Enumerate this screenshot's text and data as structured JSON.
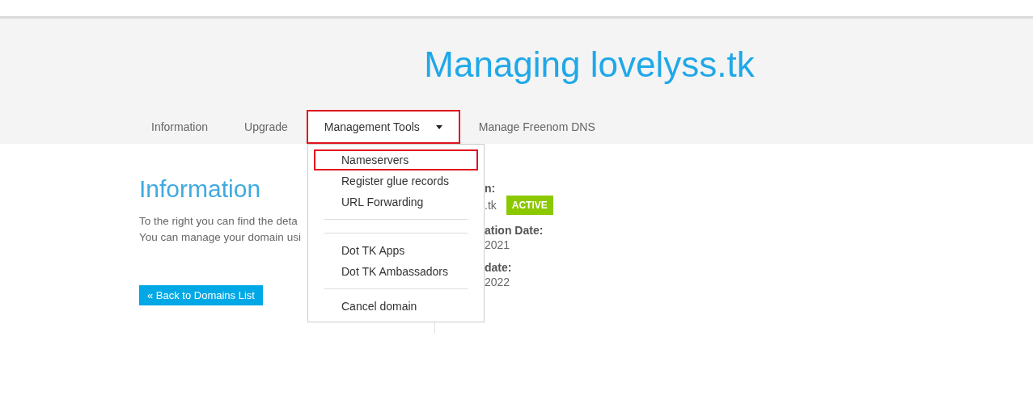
{
  "header": {
    "title": "Managing lovelyss.tk"
  },
  "tabs": [
    {
      "label": "Information",
      "selected": false,
      "highlighted": false,
      "dropdown": false
    },
    {
      "label": "Upgrade",
      "selected": false,
      "highlighted": false,
      "dropdown": false
    },
    {
      "label": "Management Tools",
      "selected": true,
      "highlighted": true,
      "dropdown": true
    },
    {
      "label": "Manage Freenom DNS",
      "selected": false,
      "highlighted": false,
      "dropdown": false
    }
  ],
  "dropdown_menu": {
    "entries": [
      {
        "kind": "item",
        "label": "Nameservers",
        "highlighted": true
      },
      {
        "kind": "item",
        "label": "Register glue records",
        "highlighted": false
      },
      {
        "kind": "item",
        "label": "URL Forwarding",
        "highlighted": false
      },
      {
        "kind": "divider"
      },
      {
        "kind": "divider"
      },
      {
        "kind": "item",
        "label": "Dot TK Apps",
        "highlighted": false
      },
      {
        "kind": "item",
        "label": "Dot TK Ambassadors",
        "highlighted": false
      },
      {
        "kind": "divider"
      },
      {
        "kind": "item",
        "label": "Cancel domain",
        "highlighted": false
      }
    ]
  },
  "information": {
    "heading": "Information",
    "lines": [
      "To the right you can find the deta",
      "You can manage your domain usi"
    ],
    "back_button": "« Back to Domains List"
  },
  "details": [
    {
      "label": "n:",
      "value": ".tk",
      "badge": "ACTIVE"
    },
    {
      "label": "ation Date:",
      "value": "2021"
    },
    {
      "label": "date:",
      "value": "2022"
    }
  ]
}
